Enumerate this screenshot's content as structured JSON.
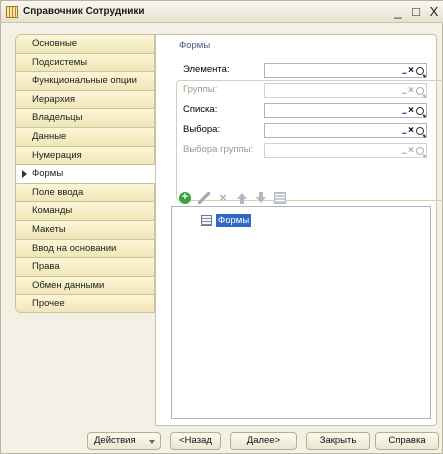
{
  "window": {
    "title": "Справочник Сотрудники",
    "controls": [
      "_",
      "□",
      "X"
    ]
  },
  "nav": {
    "items": [
      {
        "label": "Основные",
        "active": false
      },
      {
        "label": "Подсистемы",
        "active": false
      },
      {
        "label": "Функциональные опции",
        "active": false
      },
      {
        "label": "Иерархия",
        "active": false
      },
      {
        "label": "Владельцы",
        "active": false
      },
      {
        "label": "Данные",
        "active": false
      },
      {
        "label": "Нумерация",
        "active": false
      },
      {
        "label": "Формы",
        "active": true
      },
      {
        "label": "Поле ввода",
        "active": false
      },
      {
        "label": "Команды",
        "active": false
      },
      {
        "label": "Макеты",
        "active": false
      },
      {
        "label": "Ввод на основании",
        "active": false
      },
      {
        "label": "Права",
        "active": false
      },
      {
        "label": "Обмен данными",
        "active": false
      },
      {
        "label": "Прочее",
        "active": false
      }
    ]
  },
  "forms_group": {
    "title": "Формы",
    "fields": [
      {
        "label": "Элемента:",
        "value": "",
        "enabled": true
      },
      {
        "label": "Группы:",
        "value": "",
        "enabled": false
      },
      {
        "label": "Списка:",
        "value": "",
        "enabled": true
      },
      {
        "label": "Выбора:",
        "value": "",
        "enabled": true
      },
      {
        "label": "Выбора группы:",
        "value": "",
        "enabled": false
      }
    ],
    "field_buttons": {
      "select": "...",
      "clear": "×"
    }
  },
  "tree": {
    "root_label": "Формы"
  },
  "footer": {
    "actions_label": "Действия",
    "back_label": "<Назад",
    "next_label": "Далее>",
    "close_label": "Закрыть",
    "help_label": "Справка"
  }
}
